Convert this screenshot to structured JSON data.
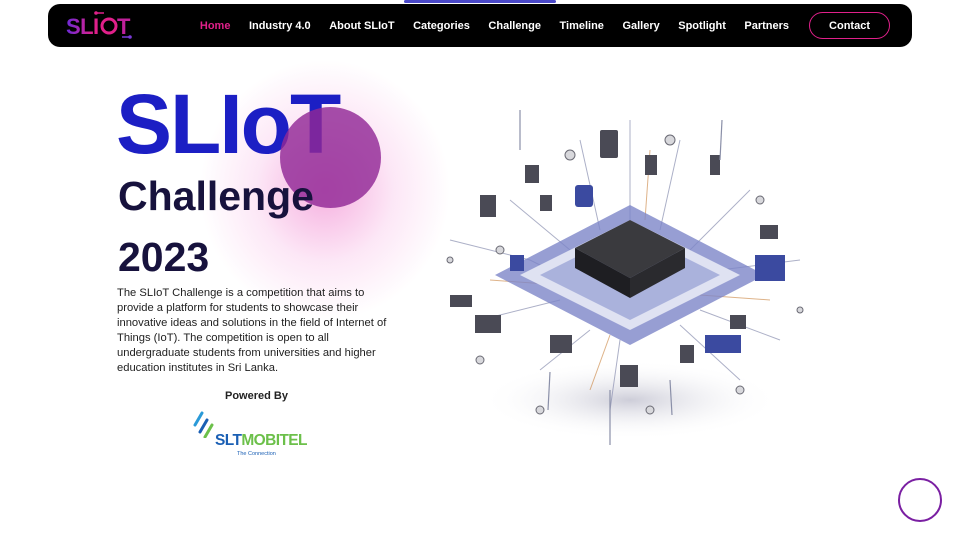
{
  "nav": {
    "logo_text": "SLIOT",
    "items": [
      {
        "label": "Home",
        "active": true
      },
      {
        "label": "Industry 4.0",
        "active": false
      },
      {
        "label": "About SLIoT",
        "active": false
      },
      {
        "label": "Categories",
        "active": false
      },
      {
        "label": "Challenge",
        "active": false
      },
      {
        "label": "Timeline",
        "active": false
      },
      {
        "label": "Gallery",
        "active": false
      },
      {
        "label": "Spotlight",
        "active": false
      },
      {
        "label": "Partners",
        "active": false
      }
    ],
    "contact_label": "Contact"
  },
  "hero": {
    "title": "SLIoT",
    "line2": "Challenge",
    "line3": "2023",
    "description": "The SLIoT Challenge is a competition that aims to provide a platform for students to showcase their innovative ideas and solutions in the field of Internet of Things (IoT). The competition is open to all undergraduate students from universities and higher education institutes in Sri Lanka.",
    "powered_by": "Powered By"
  },
  "sponsor": {
    "name_part1": "SLT",
    "name_part2": "MOBITEL",
    "tagline": "The Connection"
  },
  "colors": {
    "brand_blue": "#1c1fc4",
    "accent_pink": "#e0208a",
    "dark_navy": "#17123d",
    "chat_purple": "#7a1fa2"
  },
  "icons": {
    "hero_image": "iot-circuit-chip-illustration",
    "chat": "chat-bubble-icon"
  }
}
